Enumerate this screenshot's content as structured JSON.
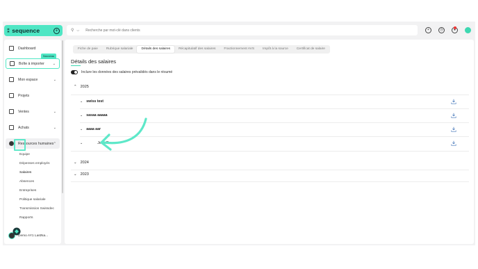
{
  "header": {
    "logo_mark": "⁑",
    "logo_text": "sequence",
    "search_placeholder": "Recherche par mot-clé dans clients"
  },
  "sidebar": {
    "items": [
      {
        "label": "Dashboard"
      },
      {
        "label": "Boîte à importer"
      },
      {
        "label": "Mon espace"
      },
      {
        "label": "Projets"
      },
      {
        "label": "Ventes"
      },
      {
        "label": "Achats"
      },
      {
        "label": "Ressources humaines"
      }
    ],
    "badge_new": "Nouveau",
    "sub_items": [
      {
        "label": "Equipe"
      },
      {
        "label": "Dépenses employés"
      },
      {
        "label": "Salaires"
      },
      {
        "label": "Absences"
      },
      {
        "label": "Entreprises"
      },
      {
        "label": "Politique salariale"
      },
      {
        "label": "Transmission Swissdec"
      },
      {
        "label": "Rapports"
      }
    ],
    "user_name": "Demo AY1 LastNa..."
  },
  "tabs": [
    {
      "label": "Fiche de paie"
    },
    {
      "label": "Rubrique salariale"
    },
    {
      "label": "Détails des salaires"
    },
    {
      "label": "Récapitulatif des salaires"
    },
    {
      "label": "Fractionnement AVS"
    },
    {
      "label": "Impôt à la source"
    },
    {
      "label": "Certificat de salaire"
    }
  ],
  "main": {
    "title": "Détails des salaires",
    "toggle_label": "Inclure les données des salaires prévalidés dans le résumé",
    "years": [
      {
        "label": "2025",
        "chev": "⌃"
      },
      {
        "label": "2024",
        "chev": "⌄"
      },
      {
        "label": "2023",
        "chev": "⌄"
      }
    ],
    "employees": [
      {
        "name": "swiss test"
      },
      {
        "name": "sasaa aaaaa"
      },
      {
        "name": "aaaa aar"
      },
      {
        "name": "John Ro"
      }
    ]
  },
  "colors": {
    "accent": "#4fe6c4",
    "download": "#3a6fb5"
  }
}
